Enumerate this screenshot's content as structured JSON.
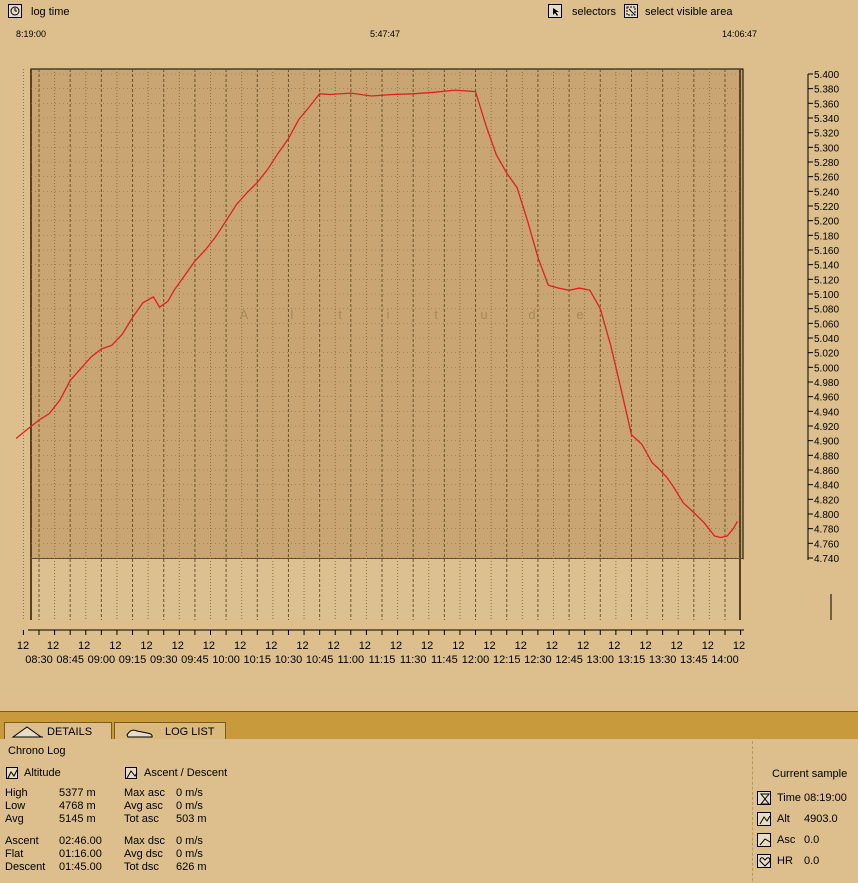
{
  "toolbar": {
    "log_time": "log time",
    "selectors": "selectors",
    "select_visible_area": "select visible area"
  },
  "time_range": {
    "start": "8:19:00",
    "mid": "5:47:47",
    "end": "14:06:47"
  },
  "watermark": [
    "A",
    "l",
    "t",
    "i",
    "t",
    "u",
    "d",
    "e"
  ],
  "chart_data": {
    "type": "line",
    "x_unit": "time",
    "ylim": [
      4740,
      5400
    ],
    "y_ticks": [
      "5.400",
      "5.380",
      "5.360",
      "5.340",
      "5.320",
      "5.300",
      "5.280",
      "5.260",
      "5.240",
      "5.220",
      "5.200",
      "5.180",
      "5.160",
      "5.140",
      "5.120",
      "5.100",
      "5.080",
      "5.060",
      "5.040",
      "5.020",
      "5.000",
      "4.980",
      "4.960",
      "4.940",
      "4.920",
      "4.900",
      "4.880",
      "4.860",
      "4.840",
      "4.820",
      "4.800",
      "4.780",
      "4.760",
      "4.740"
    ],
    "x_tick_minor": "12",
    "x_ticks": [
      "08:30",
      "08:45",
      "09:00",
      "09:15",
      "09:30",
      "09:45",
      "10:00",
      "10:15",
      "10:30",
      "10:45",
      "11:00",
      "11:15",
      "11:30",
      "11:45",
      "12:00",
      "12:15",
      "12:30",
      "12:45",
      "13:00",
      "13:15",
      "13:30",
      "13:45",
      "14:00"
    ],
    "grid": true,
    "color": "#e02020",
    "series": [
      {
        "x": [
          "08:19",
          "08:25",
          "08:30",
          "08:35",
          "08:40",
          "08:45",
          "08:50",
          "08:55",
          "09:00",
          "09:05",
          "09:10",
          "09:15",
          "09:20",
          "09:25",
          "09:28",
          "09:32",
          "09:35",
          "09:40",
          "09:45",
          "09:50",
          "09:55",
          "10:00",
          "10:05",
          "10:10",
          "10:15",
          "10:20",
          "10:25",
          "10:30",
          "10:35",
          "10:40",
          "10:45",
          "10:50",
          "11:00",
          "11:10",
          "11:20",
          "11:30",
          "11:40",
          "11:50",
          "11:55",
          "12:00",
          "12:05",
          "12:10",
          "12:15",
          "12:20",
          "12:25",
          "12:30",
          "12:35",
          "12:40",
          "12:45",
          "12:50",
          "12:55",
          "13:00",
          "13:05",
          "13:10",
          "13:15",
          "13:20",
          "13:25",
          "13:28",
          "13:32",
          "13:35",
          "13:40",
          "13:45",
          "13:50",
          "13:55",
          "13:58",
          "14:01",
          "14:04",
          "14:06"
        ],
        "y": [
          4903,
          4917,
          4928,
          4937,
          4955,
          4982,
          4998,
          5014,
          5025,
          5030,
          5045,
          5068,
          5088,
          5096,
          5082,
          5090,
          5105,
          5125,
          5145,
          5160,
          5178,
          5200,
          5222,
          5238,
          5252,
          5270,
          5292,
          5312,
          5338,
          5355,
          5373,
          5372,
          5374,
          5370,
          5372,
          5373,
          5375,
          5378,
          5377,
          5376,
          5330,
          5290,
          5265,
          5245,
          5200,
          5150,
          5112,
          5108,
          5105,
          5108,
          5105,
          5080,
          5030,
          4970,
          4908,
          4895,
          4870,
          4862,
          4850,
          4838,
          4815,
          4802,
          4788,
          4770,
          4768,
          4770,
          4780,
          4790
        ]
      }
    ]
  },
  "tabs": {
    "details": "DETAILS",
    "log_list": "LOG LIST"
  },
  "details": {
    "heading": "Chrono Log",
    "altitude_title": "Altitude",
    "ascdesc_title": "Ascent / Descent",
    "alt_rows": [
      {
        "label": "High",
        "value": "5377 m"
      },
      {
        "label": "Low",
        "value": "4768 m"
      },
      {
        "label": "Avg",
        "value": "5145 m"
      },
      {
        "label": "Ascent",
        "value": "02:46.00"
      },
      {
        "label": "Flat",
        "value": "01:16.00"
      },
      {
        "label": "Descent",
        "value": "01:45.00"
      }
    ],
    "ad_rows": [
      {
        "label": "Max asc",
        "value": "0 m/s"
      },
      {
        "label": "Avg asc",
        "value": "0 m/s"
      },
      {
        "label": "Tot asc",
        "value": "503 m"
      },
      {
        "label": "Max dsc",
        "value": "0 m/s"
      },
      {
        "label": "Avg dsc",
        "value": "0 m/s"
      },
      {
        "label": "Tot dsc",
        "value": "626 m"
      }
    ]
  },
  "current_sample": {
    "title": "Current sample",
    "time_label": "Time",
    "time_value": "08:19:00",
    "alt_label": "Alt",
    "alt_value": "4903.0",
    "asc_label": "Asc",
    "asc_value": "0.0",
    "hr_label": "HR",
    "hr_value": "0.0"
  }
}
